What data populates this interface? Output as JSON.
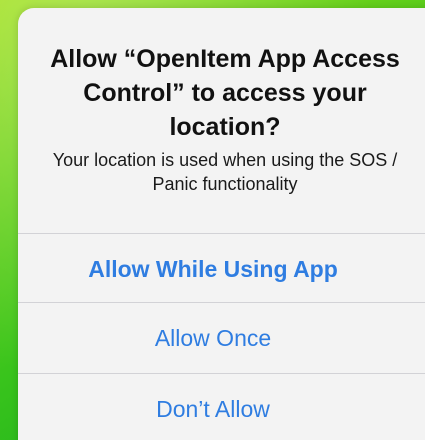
{
  "alert": {
    "title": "Allow “OpenItem App Access Control” to access your location?",
    "message": "Your location is used when using the SOS / Panic functionality",
    "buttons": {
      "allow_while_using": "Allow While Using App",
      "allow_once": "Allow Once",
      "dont_allow": "Don’t Allow"
    }
  },
  "colors": {
    "accent": "#2f7de1",
    "alert_background": "#f3f3f3",
    "wallpaper_green": "#39c41c"
  }
}
